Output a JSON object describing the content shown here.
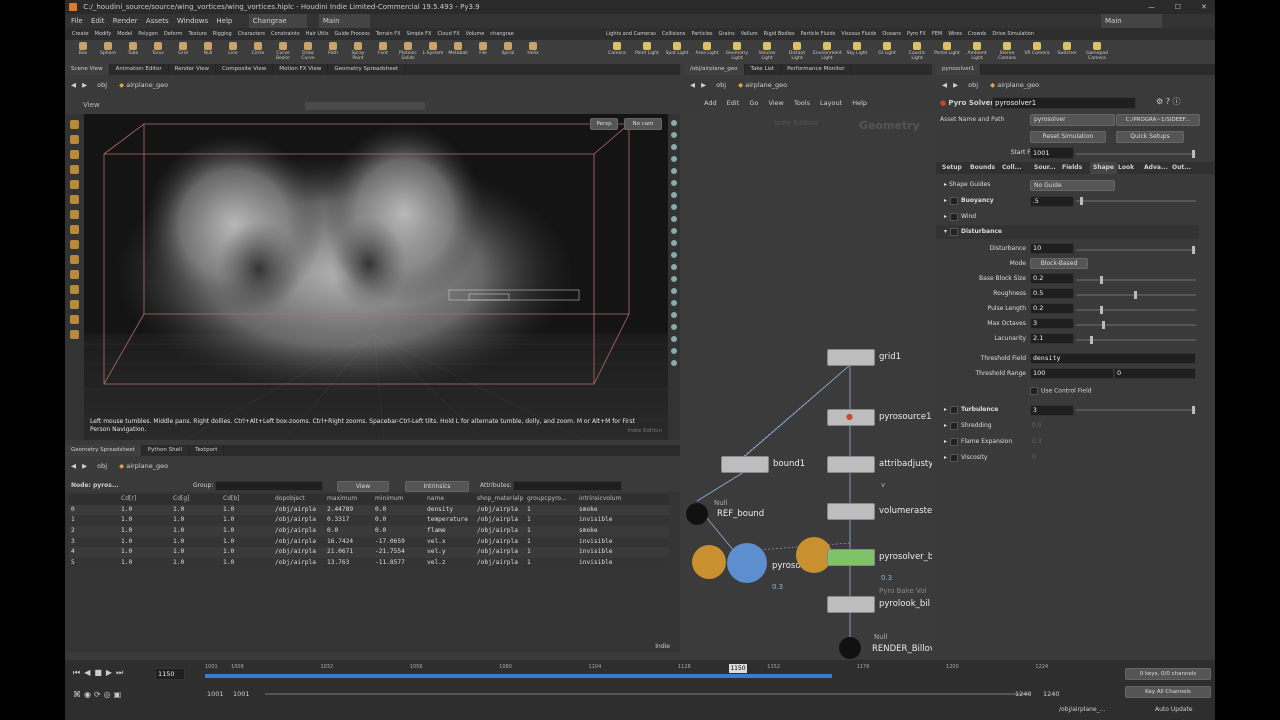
{
  "title": "C:/_houdini_source/source/wing_vortices/wing_vortices.hiplc - Houdini Indie Limited-Commercial 19.5.493 - Py3.9",
  "menu": [
    "File",
    "Edit",
    "Render",
    "Assets",
    "Windows",
    "Help"
  ],
  "desktop": "Changrae",
  "main_label": "Main",
  "main_right": "Main",
  "shelf_tabs_left": [
    "Create",
    "Modify",
    "Model",
    "Polygon",
    "Deform",
    "Texture",
    "Rigging",
    "Characters",
    "Constraints",
    "Hair Utils",
    "Guide Process",
    "Terrain FX",
    "Simple FX",
    "Cloud FX",
    "Volume",
    "changrae"
  ],
  "shelf_tabs_right": [
    "Lights and Cameras",
    "Collisions",
    "Particles",
    "Grains",
    "Vellum",
    "Rigid Bodies",
    "Particle Fluids",
    "Viscous Fluids",
    "Oceans",
    "Pyro FX",
    "FEM",
    "Wires",
    "Crowds",
    "Drive Simulation"
  ],
  "tools_left": [
    "Box",
    "Sphere",
    "Tube",
    "Torus",
    "Grid",
    "Null",
    "Line",
    "Circle",
    "Curve Bezier",
    "Draw Curve",
    "Path",
    "Spray Paint",
    "Font",
    "Platonic Solids",
    "L-System",
    "Metaball",
    "File",
    "Spiral",
    "Helix"
  ],
  "tools_right": [
    "Camera",
    "Point Light",
    "Spot Light",
    "Area Light",
    "Geometry Light",
    "Volume Light",
    "Distant Light",
    "Environment Light",
    "Sky Light",
    "GI Light",
    "Caustic Light",
    "Portal Light",
    "Ambient Light",
    "Stereo Camera",
    "VR Camera",
    "Switcher",
    "Gamepad Camera"
  ],
  "left_tabs": [
    "Scene View",
    "Animation Editor",
    "Render View",
    "Composite View",
    "Motion FX View",
    "Geometry Spreadsheet"
  ],
  "obj": "obj",
  "geo": "airplane_geo",
  "view_label": "View",
  "persp": "Persp",
  "nocam": "No cam",
  "hint": "Left mouse tumbles. Middle pans. Right dollies. Ctrl+Alt+Left box-zooms. Ctrl+Right zooms. Spacebar-Ctrl-Left tilts. Hold L for alternate tumble, dolly, and zoom.    M or Alt+M for First Person Navigation.",
  "indie_edition": "Indie Edition",
  "bottom_tabs": [
    "Geometry Spreadsheet",
    "Python Shell",
    "Textport"
  ],
  "sheet": {
    "node": "Node: pyros...",
    "group": "Group:",
    "view": "View",
    "intrinsics": "Intrinsics",
    "attributes": "Attributes:",
    "columns": [
      "",
      "Cd[r]",
      "Cd[g]",
      "Cd[b]",
      "dopobject",
      "maximum",
      "minimum",
      "name",
      "shop_materialp",
      "groupcpyro...",
      "intrinsicvolum"
    ],
    "rows": [
      [
        "0",
        "1.0",
        "1.0",
        "1.0",
        "/obj/airpla",
        "2.44789",
        "0.0",
        "density",
        "/obj/airpla",
        "1",
        "smoke"
      ],
      [
        "1",
        "1.0",
        "1.0",
        "1.0",
        "/obj/airpla",
        "0.3317",
        "0.0",
        "temperature",
        "/obj/airpla",
        "1",
        "invisible"
      ],
      [
        "2",
        "1.0",
        "1.0",
        "1.0",
        "/obj/airpla",
        "0.0",
        "0.0",
        "flame",
        "/obj/airpla",
        "1",
        "smoke"
      ],
      [
        "3",
        "1.0",
        "1.0",
        "1.0",
        "/obj/airpla",
        "16.7424",
        "-17.0659",
        "vel.x",
        "/obj/airpla",
        "1",
        "invisible"
      ],
      [
        "4",
        "1.0",
        "1.0",
        "1.0",
        "/obj/airpla",
        "21.0671",
        "-21.7554",
        "vel.y",
        "/obj/airpla",
        "1",
        "invisible"
      ],
      [
        "5",
        "1.0",
        "1.0",
        "1.0",
        "/obj/airpla",
        "13.763",
        "-11.8577",
        "vel.z",
        "/obj/airpla",
        "1",
        "invisible"
      ]
    ],
    "indie": "Indie"
  },
  "network": {
    "tabs": [
      "/obj/airplane_geo",
      "Take List",
      "Performance Monitor"
    ],
    "menu": [
      "Add",
      "Edit",
      "Go",
      "View",
      "Tools",
      "Layout",
      "Help"
    ],
    "watermark_indie": "Indie Edition",
    "watermark_ctx": "Geometry",
    "nodes": {
      "grid1": "grid1",
      "pyrosource1": "pyrosource1",
      "bound1": "bound1",
      "attribadjusty": "attribadjusty",
      "null_ref": "Null",
      "ref_bound": "REF_bound",
      "volumeraste": "volumeraste",
      "pyrosolver1": "pyrosolver1",
      "pyrosolver_b": "pyrosolver_b",
      "val_a": "0.3",
      "val_b": "0.3",
      "v_flag": "v",
      "pyro_bake_label": "Pyro Bake Vol",
      "pyrolook": "pyrolook_bil",
      "null_render": "Null",
      "render": "RENDER_Billov"
    }
  },
  "params": {
    "tab": "pyrosolver1",
    "node_type": "Pyro Solver",
    "node_name": "pyrosolver1",
    "asset_label": "Asset Name and Path",
    "asset_value": "pyrosolver",
    "asset_path": "C:/PROGRA~1/SIDEEF...",
    "reset": "Reset Simulation",
    "quick": "Quick Setups",
    "start_frame_label": "Start Frame",
    "start_frame": "1001",
    "tabs": [
      "Setup",
      "Bounds",
      "Coll...",
      "Sour...",
      "Fields",
      "Shape",
      "Look",
      "Adva...",
      "Out..."
    ],
    "shape_guides": "Shape Guides",
    "no_guide": "No Guide",
    "buoyancy": "Buoyancy",
    "buoyancy_val": ".5",
    "wind": "Wind",
    "disturbance": "Disturbance",
    "dist_label": "Disturbance",
    "dist_val": "10",
    "mode_label": "Mode",
    "mode_val": "Block-Based",
    "bbs_label": "Base Block Size",
    "bbs_val": "0.2",
    "rough_label": "Roughness",
    "rough_val": "0.5",
    "pulse_label": "Pulse Length",
    "pulse_val": "0.2",
    "oct_label": "Max Octaves",
    "oct_val": "3",
    "lac_label": "Lacunarity",
    "lac_val": "2.1",
    "thresh_field_label": "Threshold Field",
    "thresh_field_val": "density",
    "thresh_range_label": "Threshold Range",
    "thresh_range_a": "100",
    "thresh_range_b": "0",
    "use_control": "Use Control Field",
    "turbulence": "Turbulence",
    "turb_val": "3",
    "shredding": "Shredding",
    "shred_val": "0.5",
    "flame_exp": "Flame Expansion",
    "flame_val": "0.3",
    "viscosity": "Viscosity",
    "visc_val": "0"
  },
  "timeline": {
    "frame": "1150",
    "ticks": [
      "1001",
      "1008",
      "1032",
      "1056",
      "1080",
      "1104",
      "1128",
      "1152",
      "1176",
      "1200",
      "1224"
    ],
    "cursor": "1150",
    "range_start": "1001",
    "range_start2": "1001",
    "range_end": "1240",
    "range_end2": "1240",
    "keys": "0 keys, 0/0 channels",
    "key_all": "Key All Channels",
    "path": "/obj/airplane_...",
    "auto_update": "Auto Update"
  }
}
